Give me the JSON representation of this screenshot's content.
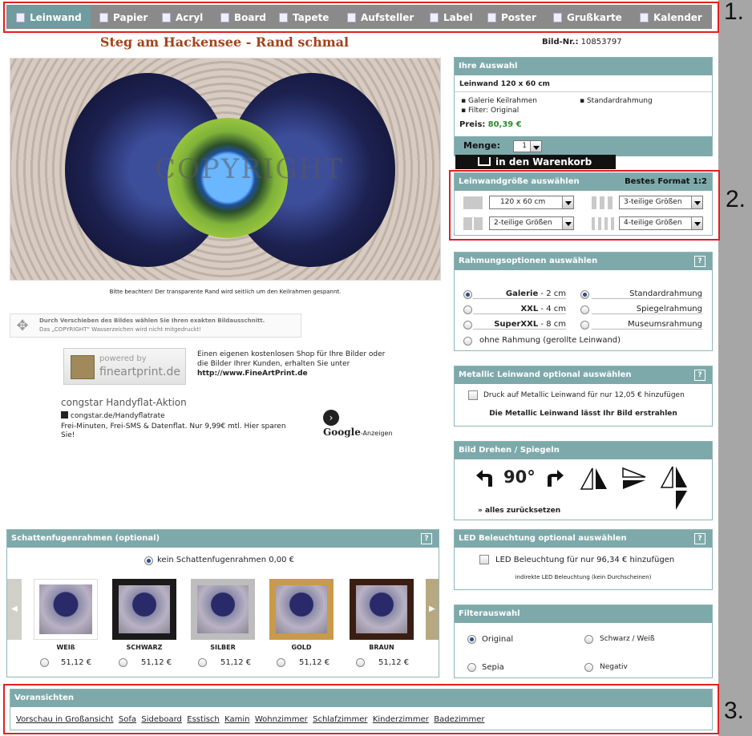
{
  "nav": {
    "items": [
      "Leinwand",
      "Papier",
      "Acryl",
      "Board",
      "Tapete",
      "Aufsteller",
      "Label",
      "Poster",
      "Grußkarte",
      "Kalender"
    ]
  },
  "title": "Steg am Hackensee - Rand schmal",
  "bild_nr": {
    "label": "Bild-Nr.:",
    "value": "10853797"
  },
  "watermark": "COPYRIGHT",
  "image_note": "Bitte beachten! Der transparente Rand wird seitlich um den Keilrahmen gespannt.",
  "move_hint": {
    "line1": "Durch Verschieben des Bildes wählen Sie Ihren exakten Bildausschnitt.",
    "line2": "Das „COPYRIGHT“ Wasserzeichen wird nicht mitgedruckt!"
  },
  "fap": {
    "powered": "powered by",
    "brand": "fineartprint.de",
    "text": "Einen eigenen kostenlosen Shop für Ihre Bilder oder die Bilder Ihrer Kunden, erhalten Sie unter",
    "link": "http://www.FineArtPrint.de"
  },
  "ad": {
    "title": "congstar Handyflat-Aktion",
    "url": "congstar.de/Handyflatrate",
    "text": "Frei-Minuten, Frei-SMS & Datenflat. Nur 9,99€ mtl. Hier sparen Sie!",
    "google": "Google",
    "anzeigen": "-Anzeigen"
  },
  "auswahl": {
    "header": "Ihre Auswahl",
    "product": "Leinwand 120 x 60 cm",
    "bullets": [
      "Galerie Keilrahmen",
      "Standardrahmung",
      "Filter: Original"
    ],
    "preis_label": "Preis:",
    "preis": "80,39 €",
    "menge_label": "Menge:",
    "menge": "1",
    "cart": "in den Warenkorb"
  },
  "groesse": {
    "header": "Leinwandgröße auswählen",
    "best": "Bestes Format 1:2",
    "selects": [
      "120 x 60 cm",
      "2-teilige Größen",
      "3-teilige Größen",
      "4-teilige Größen"
    ]
  },
  "rahmung": {
    "header": "Rahmungsoptionen auswählen",
    "help": "?",
    "left": [
      {
        "name": "Galerie",
        "size": "- 2 cm",
        "checked": true
      },
      {
        "name": "XXL",
        "size": "- 4 cm",
        "checked": false
      },
      {
        "name": "SuperXXL",
        "size": "- 8 cm",
        "checked": false
      }
    ],
    "right": [
      {
        "name": "Standardrahmung",
        "checked": true
      },
      {
        "name": "Spiegelrahmung",
        "checked": false
      },
      {
        "name": "Museumsrahmung",
        "checked": false
      }
    ],
    "none": "ohne Rahmung (gerollte Leinwand)"
  },
  "metallic": {
    "header": "Metallic Leinwand optional auswählen",
    "help": "?",
    "option": "Druck auf Metallic Leinwand für nur 12,05 € hinzufügen",
    "tagline": "Die Metallic Leinwand lässt Ihr Bild erstrahlen"
  },
  "drehen": {
    "header": "Bild Drehen / Spiegeln",
    "deg": "90°",
    "reset": "» alles zurücksetzen"
  },
  "schatten": {
    "header": "Schattenfugenrahmen (optional)",
    "help": "?",
    "none_option": "kein Schattenfugenrahmen 0,00 €",
    "frames": [
      {
        "label": "WEIß",
        "price": "51,12 €",
        "color": "#ffffff"
      },
      {
        "label": "SCHWARZ",
        "price": "51,12 €",
        "color": "#1a1a1a"
      },
      {
        "label": "SILBER",
        "price": "51,12 €",
        "color": "#bdbdbd"
      },
      {
        "label": "GOLD",
        "price": "51,12 €",
        "color": "#c89a4a"
      },
      {
        "label": "BRAUN",
        "price": "51,12 €",
        "color": "#3a1e12"
      }
    ]
  },
  "led": {
    "header": "LED Beleuchtung optional auswählen",
    "help": "?",
    "option": "LED Beleuchtung für nur 96,34 € hinzufügen",
    "note": "indirekte LED Beleuchtung (kein Durchscheinen)"
  },
  "filter": {
    "header": "Filterauswahl",
    "options": [
      {
        "label": "Original",
        "checked": true
      },
      {
        "label": "Schwarz / Weiß",
        "checked": false
      },
      {
        "label": "Sepia",
        "checked": false
      },
      {
        "label": "Negativ",
        "checked": false
      }
    ]
  },
  "voransichten": {
    "header": "Voransichten",
    "links": [
      "Vorschau in Großansicht",
      "Sofa",
      "Sideboard",
      "Esstisch",
      "Kamin",
      "Wohnzimmer",
      "Schlafzimmer",
      "Kinderzimmer",
      "Badezimmer"
    ]
  },
  "markers": [
    "1.",
    "2.",
    "3."
  ],
  "colors": {
    "nav_bg": "#8a8a8a",
    "nav_active": "#6e9c9f",
    "panel_header": "#7ea9aa",
    "title": "#a0441a",
    "price": "#2e8b2e",
    "gray_strip": "#a6a6a6",
    "highlight": "#e02020"
  }
}
